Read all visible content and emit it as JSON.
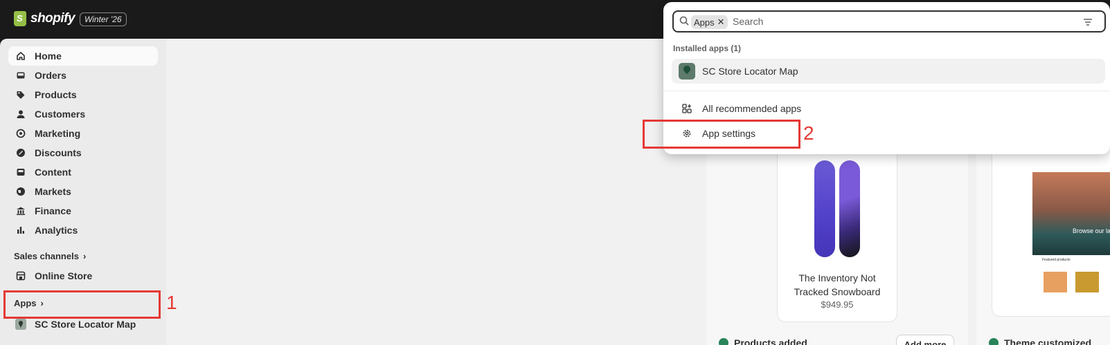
{
  "topbar": {
    "brand": "shopify",
    "badge": "Winter '26"
  },
  "sidebar": {
    "items": [
      {
        "label": "Home",
        "icon": "home-icon"
      },
      {
        "label": "Orders",
        "icon": "inbox-icon"
      },
      {
        "label": "Products",
        "icon": "tag-icon"
      },
      {
        "label": "Customers",
        "icon": "person-icon"
      },
      {
        "label": "Marketing",
        "icon": "target-icon"
      },
      {
        "label": "Discounts",
        "icon": "discount-icon"
      },
      {
        "label": "Content",
        "icon": "content-icon"
      },
      {
        "label": "Markets",
        "icon": "globe-icon"
      },
      {
        "label": "Finance",
        "icon": "bank-icon"
      },
      {
        "label": "Analytics",
        "icon": "bar-chart-icon"
      }
    ],
    "sales_channels_title": "Sales channels",
    "online_store": "Online Store",
    "apps_title": "Apps",
    "app_item": "SC Store Locator Map"
  },
  "search": {
    "chip": "Apps",
    "placeholder": "Search"
  },
  "dropdown": {
    "installed_title": "Installed apps (1)",
    "installed_app": "SC Store Locator Map",
    "all_recommended": "All recommended apps",
    "app_settings": "App settings"
  },
  "product": {
    "name_line1": "The Inventory Not",
    "name_line2": "Tracked Snowboard",
    "price": "$949.95"
  },
  "status": {
    "products_added": "Products added",
    "add_more": "Add more",
    "theme_customized": "Theme customized"
  },
  "theme_preview": {
    "browse": "Browse our late",
    "featured": "Featured products"
  },
  "annotations": {
    "one": "1",
    "two": "2"
  },
  "colors": {
    "highlight": "#e53935",
    "topbar": "#1a1a1a",
    "success": "#29845a"
  }
}
